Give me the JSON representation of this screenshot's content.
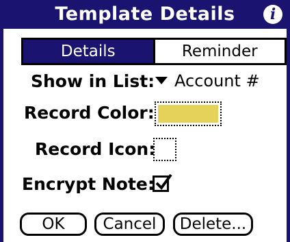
{
  "dialog": {
    "title": "Template Details",
    "info_icon": "i"
  },
  "tabs": [
    {
      "label": "Details",
      "active": true
    },
    {
      "label": "Reminder",
      "active": false
    }
  ],
  "fields": {
    "show_in_list_label": "Show in List:",
    "show_in_list_value": "Account #",
    "record_color_label": "Record Color:",
    "record_color_value": "#e5d25a",
    "record_icon_label": "Record Icon:",
    "encrypt_note_label": "Encrypt Note:",
    "encrypt_note_checked": true
  },
  "buttons": {
    "ok": "OK",
    "cancel": "Cancel",
    "delete": "Delete..."
  },
  "colors": {
    "accent": "#1a1370"
  }
}
